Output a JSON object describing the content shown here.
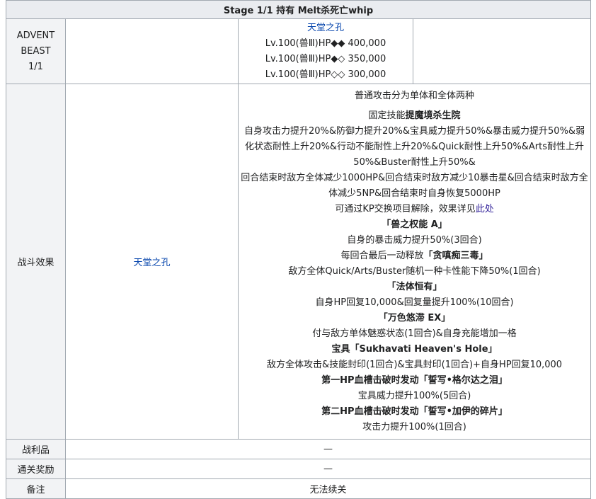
{
  "table": {
    "caption": "Stage 1/1 持有 Melt杀死亡whip",
    "enemy": {
      "class_label_lines": [
        "ADVENT",
        "BEAST",
        "1/1"
      ],
      "name": "天堂之孔",
      "hp_lines": [
        "Lv.100(兽Ⅲ)HP◆◆ 400,000",
        "Lv.100(兽Ⅲ)HP◆◇ 350,000",
        "Lv.100(兽Ⅲ)HP◇◇ 300,000"
      ]
    },
    "battle": {
      "label": "战斗效果",
      "subject": "天堂之孔",
      "effects": [
        {
          "text": "普通攻击分为单体和全体两种",
          "bold": false
        },
        {
          "gap": true
        },
        {
          "text_pre": "固定技能",
          "text_bold": "提魔境杀生院",
          "mixed": true
        },
        {
          "text": "自身攻击力提升20%&防御力提升20%&宝具威力提升50%&暴击威力提升50%&弱化状态耐性上升20%&行动不能耐性上升20%&Quick耐性上升50%&Arts耐性上升50%&Buster耐性上升50%&",
          "bold": false,
          "wrap": true
        },
        {
          "text": "回合结束时敌方全体减少1000HP&回合结束时敌方减少10暴击星&回合结束时敌方全体减少5NP&回合结束时自身恢复5000HP",
          "bold": false,
          "wrap": true
        },
        {
          "text_pre": "可通过KP交换项目解除，效果详见",
          "text_link": "此处",
          "link": true
        },
        {
          "text": "「兽之权能 A」",
          "bold": true
        },
        {
          "text": "自身的暴击威力提升50%(3回合)",
          "bold": false
        },
        {
          "text_pre": "每回合最后一动释放",
          "text_bold": "「贪嗔痴三毒」",
          "mixed": true
        },
        {
          "text": "敌方全体Quick/Arts/Buster随机一种卡性能下降50%(1回合)",
          "bold": false
        },
        {
          "text": "「法体恒有」",
          "bold": true
        },
        {
          "text": "自身HP回复10,000&回复量提升100%(10回合)",
          "bold": false
        },
        {
          "text": "「万色悠滞 EX」",
          "bold": true
        },
        {
          "text": "付与敌方单体魅惑状态(1回合)&自身充能增加一格",
          "bold": false
        },
        {
          "text": "宝具「Sukhavati Heaven's Hole」",
          "bold": true
        },
        {
          "text": "敌方全体攻击&技能封印(1回合)&宝具封印(1回合)+自身HP回复10,000",
          "bold": false
        },
        {
          "text": "第一HP血槽击破时发动「誓写•格尔达之泪」",
          "bold": true
        },
        {
          "text": "宝具威力提升100%(5回合)",
          "bold": false
        },
        {
          "text": "第二HP血槽击破时发动「誓写•加伊的碎片」",
          "bold": true
        },
        {
          "text": "攻击力提升100%(1回合)",
          "bold": false
        }
      ]
    },
    "drops": {
      "label": "战利品",
      "value": "—"
    },
    "reward": {
      "label": "通关奖励",
      "value": "—"
    },
    "notes": {
      "label": "备注",
      "value": "无法续关"
    }
  }
}
